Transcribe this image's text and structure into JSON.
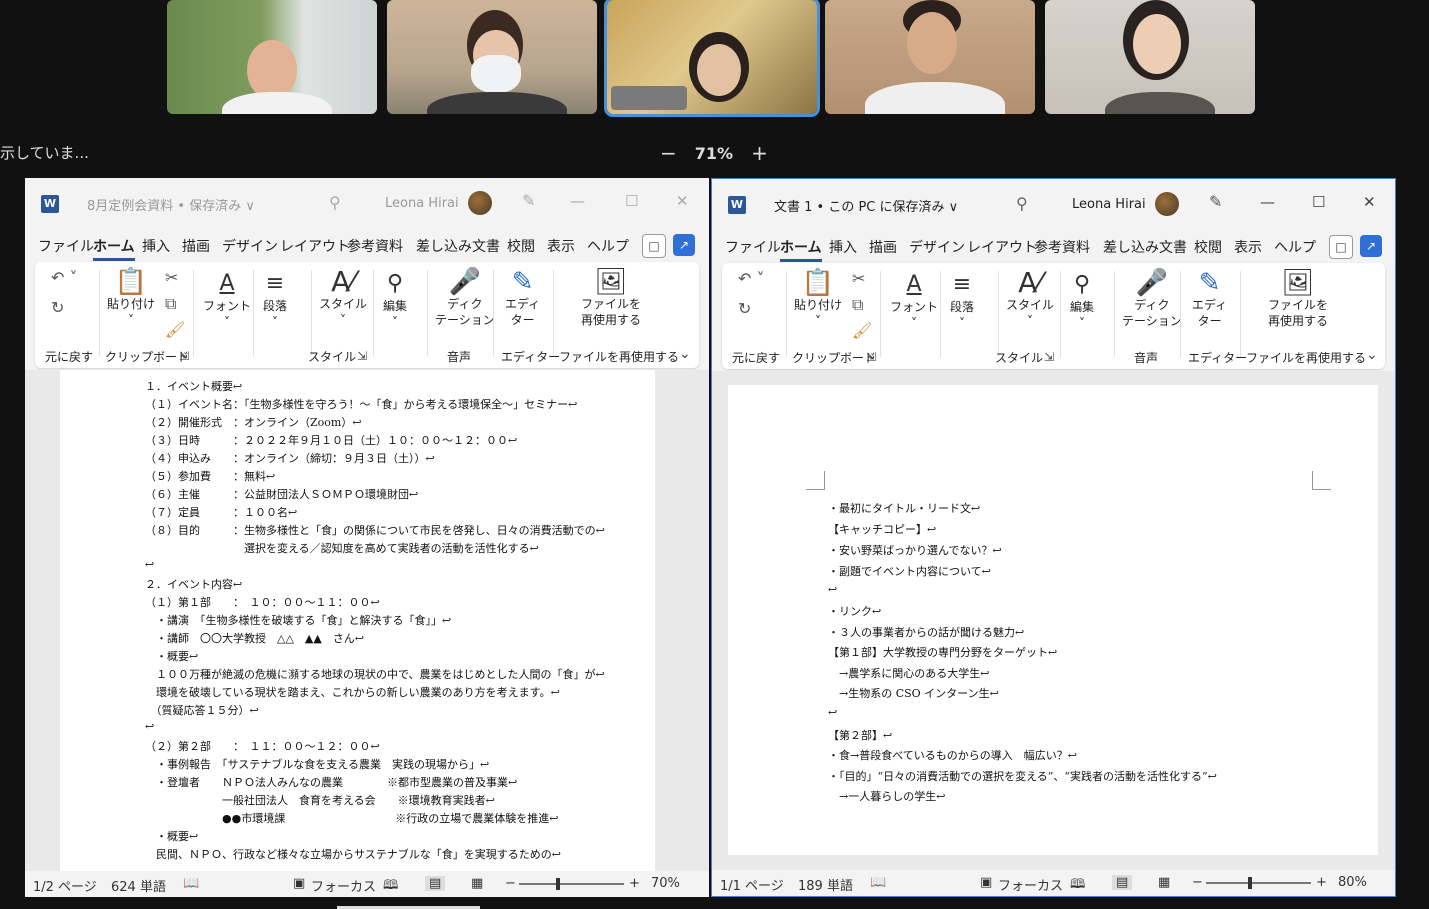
{
  "meeting": {
    "status_text": "示していま...",
    "zoom_minus": "−",
    "zoom_level": "71%",
    "zoom_plus": "+"
  },
  "left_window": {
    "title": "8月定例会資料 • 保存済み ∨",
    "user": "Leona Hirai",
    "menus": [
      "ファイル",
      "ホーム",
      "挿入",
      "描画",
      "デザイン",
      "レイアウト",
      "参考資料",
      "差し込み文書",
      "校閲",
      "表示",
      "ヘルプ"
    ],
    "ribbon": {
      "undo_group": "元に戻す",
      "paste": "貼り付け",
      "clipboard_group": "クリップボード",
      "font": "フォント",
      "paragraph": "段落",
      "styles": "スタイル",
      "styles_group": "スタイル",
      "editing": "編集",
      "dictate_1": "ディク",
      "dictate_2": "テーション",
      "voice_group": "音声",
      "editor_1": "エディ",
      "editor_2": "ター",
      "editor_group": "エディター",
      "reuse_1": "ファイルを",
      "reuse_2": "再使用する",
      "reuse_group": "ファイルを再使用する"
    },
    "doc_lines": [
      "１．イベント概要↩",
      "（１）イベント名：「生物多様性を守ろう！～「食」から考える環境保全～」セミナー↩",
      "（２）開催形式　：オンライン（Zoom）↩",
      "（３）日時　　　：２０２２年９月１０日（土）１０：００～１２：００↩",
      "（４）申込み　　：オンライン（締切：９月３日（土））↩",
      "（５）参加費　　：無料↩",
      "（６）主催　　　：公益財団法人ＳＯＭＰＯ環境財団↩",
      "（７）定員　　　：１００名↩",
      "（８）目的　　　：生物多様性と「食」の関係について市民を啓発し、日々の消費活動での↩",
      "　　　　　　　　　選択を変える／認知度を高めて実践者の活動を活性化する↩",
      "↩",
      "２．イベント内容↩",
      "（１）第１部　　：　１０：００～１１：００↩",
      "　・講演　「生物多様性を破壊する「食」と解決する「食」」↩",
      "　・講師　〇〇大学教授　△△　▲▲　さん↩",
      "　・概要↩",
      "　１００万種が絶滅の危機に瀕する地球の現状の中で、農業をはじめとした人間の「食」が↩",
      "　環境を破壊している現状を踏まえ、これからの新しい農業のあり方を考えます。↩",
      "　（質疑応答１５分）↩",
      "↩",
      "（２）第２部　　：　１１：００～１２：００↩",
      "　・事例報告　「サステナブルな食を支える農業　実践の現場から」↩",
      "　・登壇者　　ＮＰＯ法人みんなの農業　　　　※都市型農業の普及事業↩",
      "　　　　　　　一般社団法人　食育を考える会　　※環境教育実践者↩",
      "　　　　　　　●●市環境課　　　　　　　　　　※行政の立場で農業体験を推進↩",
      "　・概要↩",
      "　民間、ＮＰＯ、行政など様々な立場からサステナブルな「食」を実現するための↩"
    ],
    "status": {
      "page": "1/2 ページ",
      "words": "624 単語",
      "focus": "フォーカス",
      "zoom": "70%",
      "zoom_fraction": 0.35
    }
  },
  "right_window": {
    "title": "文書 1 • この PC に保存済み ∨",
    "user": "Leona Hirai",
    "menus": [
      "ファイル",
      "ホーム",
      "挿入",
      "描画",
      "デザイン",
      "レイアウト",
      "参考資料",
      "差し込み文書",
      "校閲",
      "表示",
      "ヘルプ"
    ],
    "ribbon": {
      "undo_group": "元に戻す",
      "paste": "貼り付け",
      "clipboard_group": "クリップボード",
      "font": "フォント",
      "paragraph": "段落",
      "styles": "スタイル",
      "styles_group": "スタイル",
      "editing": "編集",
      "dictate_1": "ディク",
      "dictate_2": "テーション",
      "voice_group": "音声",
      "editor_1": "エディ",
      "editor_2": "ター",
      "editor_group": "エディター",
      "reuse_1": "ファイルを",
      "reuse_2": "再使用する",
      "reuse_group": "ファイルを再使用する"
    },
    "doc_lines": [
      "・最初にタイトル・リード文↩",
      "【キャッチコピー】↩",
      "・安い野菜ばっかり選んでない？↩",
      "・副題でイベント内容について↩",
      "↩",
      "・リンク↩",
      "・３人の事業者からの話が聞ける魅力↩",
      "【第１部】大学教授の専門分野をターゲット↩",
      "　→農学系に関心のある大学生↩",
      "　→生物系の CSO インターン生↩",
      "↩",
      "【第２部】↩",
      "・食→普段食べているものからの導入　幅広い？↩",
      "・「目的」“日々の消費活動での選択を変える”、“実践者の活動を活性化する”↩",
      "　→一人暮らしの学生↩"
    ],
    "status": {
      "page": "1/1 ページ",
      "words": "189 単語",
      "focus": "フォーカス",
      "zoom": "80%",
      "zoom_fraction": 0.4
    }
  },
  "icons": {
    "search": "search-icon",
    "pen": "pen-icon",
    "minimize": "minimize-icon",
    "maximize": "maximize-icon",
    "close": "close-icon"
  }
}
